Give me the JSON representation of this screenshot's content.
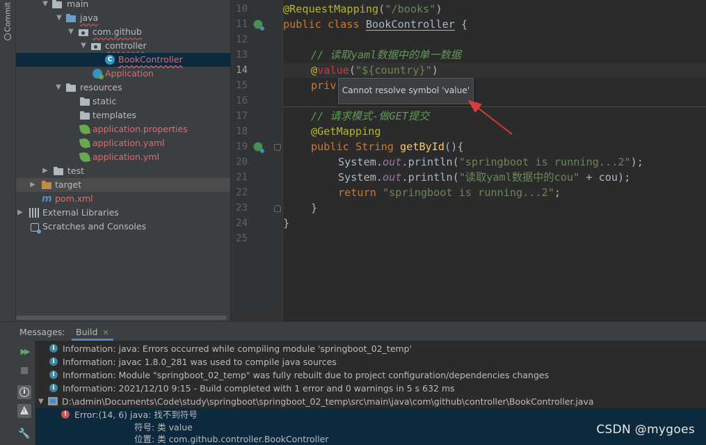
{
  "sidebar": {
    "commit_tab": "Commit"
  },
  "project_tree": {
    "items": [
      {
        "label": "main",
        "style": "",
        "icon": "folder-icon"
      },
      {
        "label": "java",
        "style": "u",
        "icon": "source-folder-icon"
      },
      {
        "label": "com.github",
        "style": "u",
        "icon": "package-icon"
      },
      {
        "label": "controller",
        "style": "u",
        "icon": "package-icon"
      },
      {
        "label": "BookController",
        "style": "red-u",
        "icon": "java-class-icon"
      },
      {
        "label": "Application",
        "style": "red",
        "icon": "spring-boot-app-icon"
      },
      {
        "label": "resources",
        "style": "",
        "icon": "resources-folder-icon"
      },
      {
        "label": "static",
        "style": "",
        "icon": "folder-icon"
      },
      {
        "label": "templates",
        "style": "",
        "icon": "folder-icon"
      },
      {
        "label": "application.properties",
        "style": "red",
        "icon": "spring-config-icon"
      },
      {
        "label": "application.yaml",
        "style": "red",
        "icon": "spring-config-icon"
      },
      {
        "label": "application.yml",
        "style": "red",
        "icon": "spring-config-icon"
      },
      {
        "label": "test",
        "style": "",
        "icon": "folder-icon"
      },
      {
        "label": "target",
        "style": "",
        "icon": "excluded-folder-icon"
      },
      {
        "label": "pom.xml",
        "style": "red",
        "icon": "maven-icon"
      },
      {
        "label": "External Libraries",
        "style": "",
        "icon": "libraries-icon"
      },
      {
        "label": "Scratches and Consoles",
        "style": "",
        "icon": "scratches-icon"
      }
    ]
  },
  "editor": {
    "line_numbers": [
      "10",
      "11",
      "12",
      "13",
      "14",
      "15",
      "16",
      "17",
      "18",
      "19",
      "20",
      "21",
      "22",
      "23",
      "24",
      "25"
    ],
    "code": {
      "l10_annot": "@RequestMapping",
      "l10_open": "(",
      "l10_str": "\"/books\"",
      "l10_close": ")",
      "l11_kw": "public class ",
      "l11_cls": "BookController",
      "l11_brace": " {",
      "l13_comment": "// 读取yaml数据中的单一数据",
      "l14_at": "@",
      "l14_err": "value",
      "l14_open": "(",
      "l14_str": "\"${country}\"",
      "l14_close": ")",
      "l15_kw": "priv",
      "l17_comment": "// 请求模式-做GET提交",
      "l18_annot": "@GetMapping",
      "l19_kw": "public ",
      "l19_type": "String ",
      "l19_fn": "getById",
      "l19_rest": "(){",
      "l20_sys": "System.",
      "l20_out": "out",
      "l20_call": ".println(",
      "l20_str": "\"springboot is running...2\"",
      "l20_end": ");",
      "l21_sys": "System.",
      "l21_out": "out",
      "l21_call": ".println(",
      "l21_str": "\"读取yaml数据中的cou\"",
      "l21_plus": " + ",
      "l21_var": "cou",
      "l21_end": ");",
      "l22_kw": "return ",
      "l22_str": "\"springboot is running...2\"",
      "l22_end": ";",
      "l23": "}",
      "l24": "}"
    },
    "tooltip": "Cannot resolve symbol 'value'"
  },
  "bottom_panel": {
    "messages_label": "Messages:",
    "build_tab": "Build",
    "messages": [
      "Information: java: Errors occurred while compiling module 'springboot_02_temp'",
      "Information: javac 1.8.0_281 was used to compile java sources",
      "Information: Module \"springboot_02_temp\" was fully rebuilt due to project configuration/dependencies changes",
      "Information: 2021/12/10 9:15 - Build completed with 1 error and 0 warnings in 5 s 632 ms"
    ],
    "file_path": "D:\\admin\\Documents\\Code\\study\\springboot\\springboot_02_temp\\src\\main\\java\\com\\github\\controller\\BookController.java",
    "error_line": "Error:(14, 6)  java: 找不到符号",
    "detail_symbol": "符号:   类 value",
    "detail_location": "位置: 类 com.github.controller.BookController"
  },
  "watermark": "CSDN @mygoes",
  "colors": {
    "error_arrow": "#d93a3a",
    "selection": "#0d293e",
    "accent_tab": "#4a88c7"
  }
}
